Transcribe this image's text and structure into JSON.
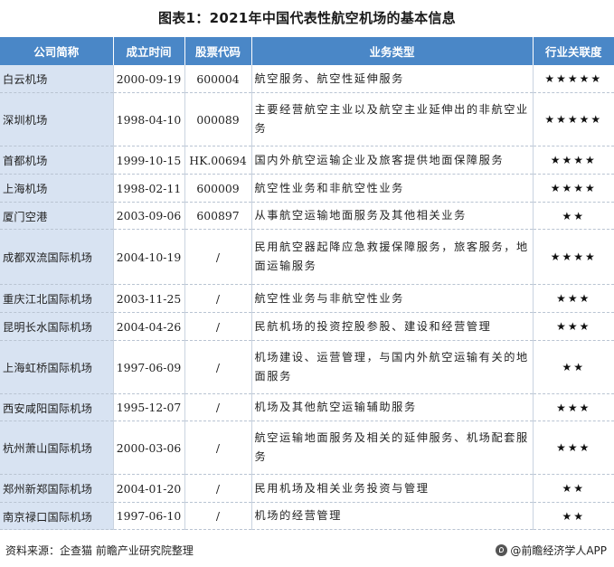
{
  "title": "图表1：2021年中国代表性航空机场的基本信息",
  "table": {
    "headers": [
      "公司简称",
      "成立时间",
      "股票代码",
      "业务类型",
      "行业关联度"
    ],
    "rows": [
      {
        "name": "白云机场",
        "date": "2000-09-19",
        "code": "600004",
        "biz": "航空服务、航空性延伸服务",
        "stars": "★★★★★"
      },
      {
        "name": "深圳机场",
        "date": "1998-04-10",
        "code": "000089",
        "biz": "主要经营航空主业以及航空主业延伸出的非航空业务",
        "stars": "★★★★★"
      },
      {
        "name": "首都机场",
        "date": "1999-10-15",
        "code": "HK.00694",
        "biz": "国内外航空运输企业及旅客提供地面保障服务",
        "stars": "★★★★"
      },
      {
        "name": "上海机场",
        "date": "1998-02-11",
        "code": "600009",
        "biz": "航空性业务和非航空性业务",
        "stars": "★★★★"
      },
      {
        "name": "厦门空港",
        "date": "2003-09-06",
        "code": "600897",
        "biz": "从事航空运输地面服务及其他相关业务",
        "stars": "★★"
      },
      {
        "name": "成都双流国际机场",
        "date": "2004-10-19",
        "code": "/",
        "biz": "民用航空器起降应急救援保障服务，旅客服务，地面运输服务",
        "stars": "★★★★"
      },
      {
        "name": "重庆江北国际机场",
        "date": "2003-11-25",
        "code": "/",
        "biz": "航空性业务与非航空性业务",
        "stars": "★★★"
      },
      {
        "name": "昆明长水国际机场",
        "date": "2004-04-26",
        "code": "/",
        "biz": "民航机场的投资控股参股、建设和经营管理",
        "stars": "★★★"
      },
      {
        "name": "上海虹桥国际机场",
        "date": "1997-06-09",
        "code": "/",
        "biz": "机场建设、运营管理，与国内外航空运输有关的地面服务",
        "stars": "★★"
      },
      {
        "name": "西安咸阳国际机场",
        "date": "1995-12-07",
        "code": "/",
        "biz": "机场及其他航空运输辅助服务",
        "stars": "★★★"
      },
      {
        "name": "杭州萧山国际机场",
        "date": "2000-03-06",
        "code": "/",
        "biz": "航空运输地面服务及相关的延伸服务、机场配套服务",
        "stars": "★★★"
      },
      {
        "name": "郑州新郑国际机场",
        "date": "2004-01-20",
        "code": "/",
        "biz": "民用机场及相关业务投资与管理",
        "stars": "★★"
      },
      {
        "name": "南京禄口国际机场",
        "date": "1997-06-10",
        "code": "/",
        "biz": "机场的经营管理",
        "stars": "★★"
      }
    ]
  },
  "footer": {
    "source": "资料来源：企查猫 前瞻产业研究院整理",
    "brand": "@前瞻经济学人APP"
  }
}
